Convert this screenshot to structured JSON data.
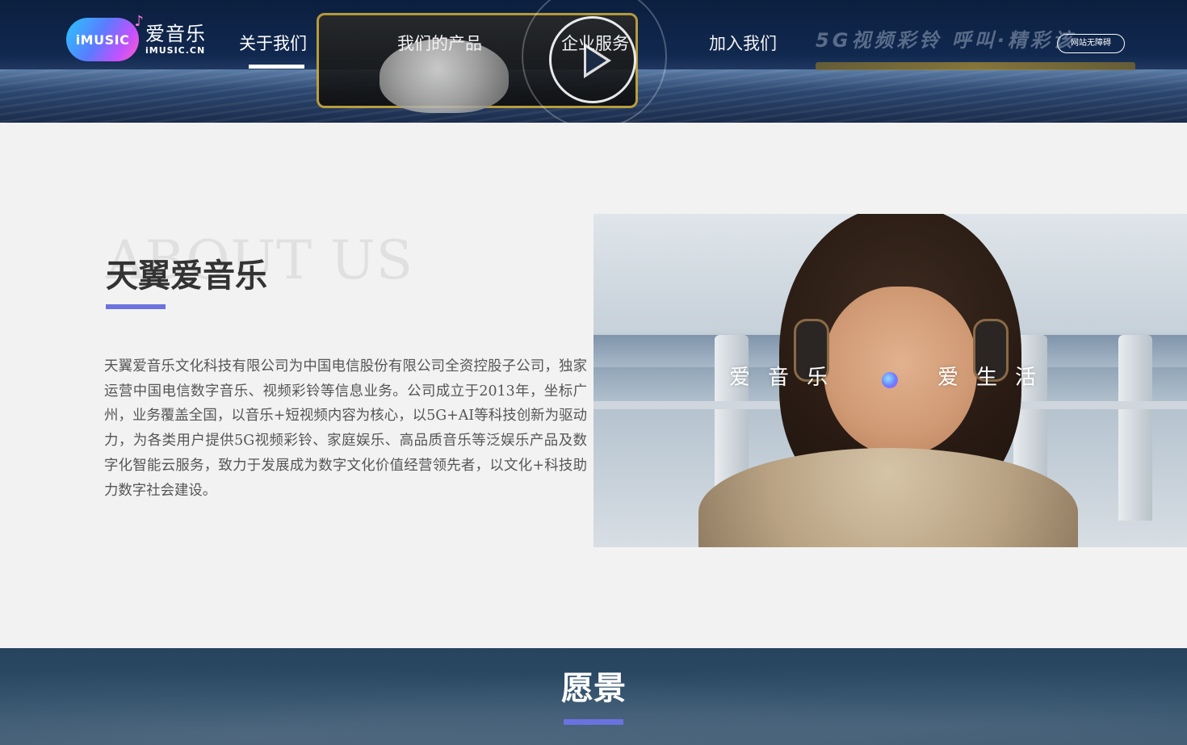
{
  "header": {
    "logo": {
      "badge_text": "iMUSIC",
      "name": "爱音乐",
      "domain": "iMUSIC.CN"
    },
    "nav": [
      {
        "label": "关于我们",
        "active": true
      },
      {
        "label": "我们的产品",
        "active": false
      },
      {
        "label": "企业服务",
        "active": false
      },
      {
        "label": "加入我们",
        "active": false
      }
    ],
    "accessibility_label": "网站无障碍",
    "banner_promo_text": "5G视频彩铃 呼叫·精彩该"
  },
  "about": {
    "background_text": "ABOUT US",
    "title": "天翼爱音乐",
    "body": "天翼爱音乐文化科技有限公司为中国电信股份有限公司全资控股子公司，独家运营中国电信数字音乐、视频彩铃等信息业务。公司成立于2013年，坐标广州，业务覆盖全国，以音乐+短视频内容为核心，以5G+AI等科技创新为驱动力，为各类用户提供5G视频彩铃、家庭娱乐、高品质音乐等泛娱乐产品及数字化智能云服务，致力于发展成为数字文化价值经营领先者，以文化+科技助力数字社会建设。",
    "photo_slogan_left": "爱音乐",
    "photo_slogan_right": "爱生活"
  },
  "vision": {
    "title": "愿景"
  },
  "colors": {
    "accent": "#6a72e0",
    "header_bg": "#0b1f3f",
    "page_bg": "#f2f2f2",
    "vision_bg": "#2c4b66"
  },
  "icons": {
    "play": "play-icon",
    "music_note": "music-note-icon"
  }
}
